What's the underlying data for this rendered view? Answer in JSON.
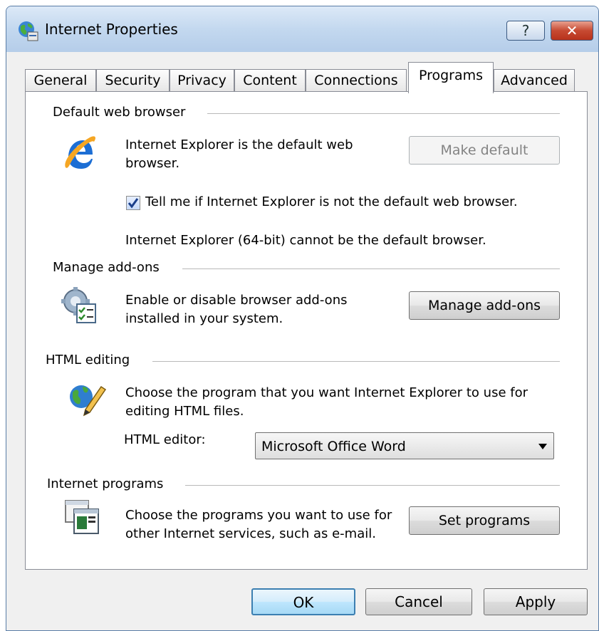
{
  "window": {
    "title": "Internet Properties",
    "help_label": "?",
    "close_label": "✕",
    "icon": "globe-icon"
  },
  "tabs": [
    {
      "label": "General"
    },
    {
      "label": "Security"
    },
    {
      "label": "Privacy"
    },
    {
      "label": "Content"
    },
    {
      "label": "Connections"
    },
    {
      "label": "Programs",
      "active": true
    },
    {
      "label": "Advanced"
    }
  ],
  "default_browser": {
    "title": "Default web browser",
    "description": "Internet Explorer is the default web browser.",
    "make_default_label": "Make default",
    "checkbox_label": "Tell me if Internet Explorer is not the default web browser.",
    "checkbox_checked": true,
    "note": "Internet Explorer (64-bit) cannot be the default browser.",
    "icon": "internet-explorer-icon"
  },
  "addons": {
    "title": "Manage add-ons",
    "description": "Enable or disable browser add-ons installed in your system.",
    "button_label": "Manage add-ons",
    "icon": "gear-checklist-icon"
  },
  "html_editing": {
    "title": "HTML editing",
    "description": "Choose the program that you want Internet Explorer to use for editing HTML files.",
    "editor_label": "HTML editor:",
    "editor_value": "Microsoft Office Word",
    "icon": "globe-pencil-icon"
  },
  "internet_programs": {
    "title": "Internet programs",
    "description": "Choose the programs you want to use for other Internet services, such as e-mail.",
    "button_label": "Set programs",
    "icon": "program-windows-icon"
  },
  "footer": {
    "ok_label": "OK",
    "cancel_label": "Cancel",
    "apply_label": "Apply"
  }
}
